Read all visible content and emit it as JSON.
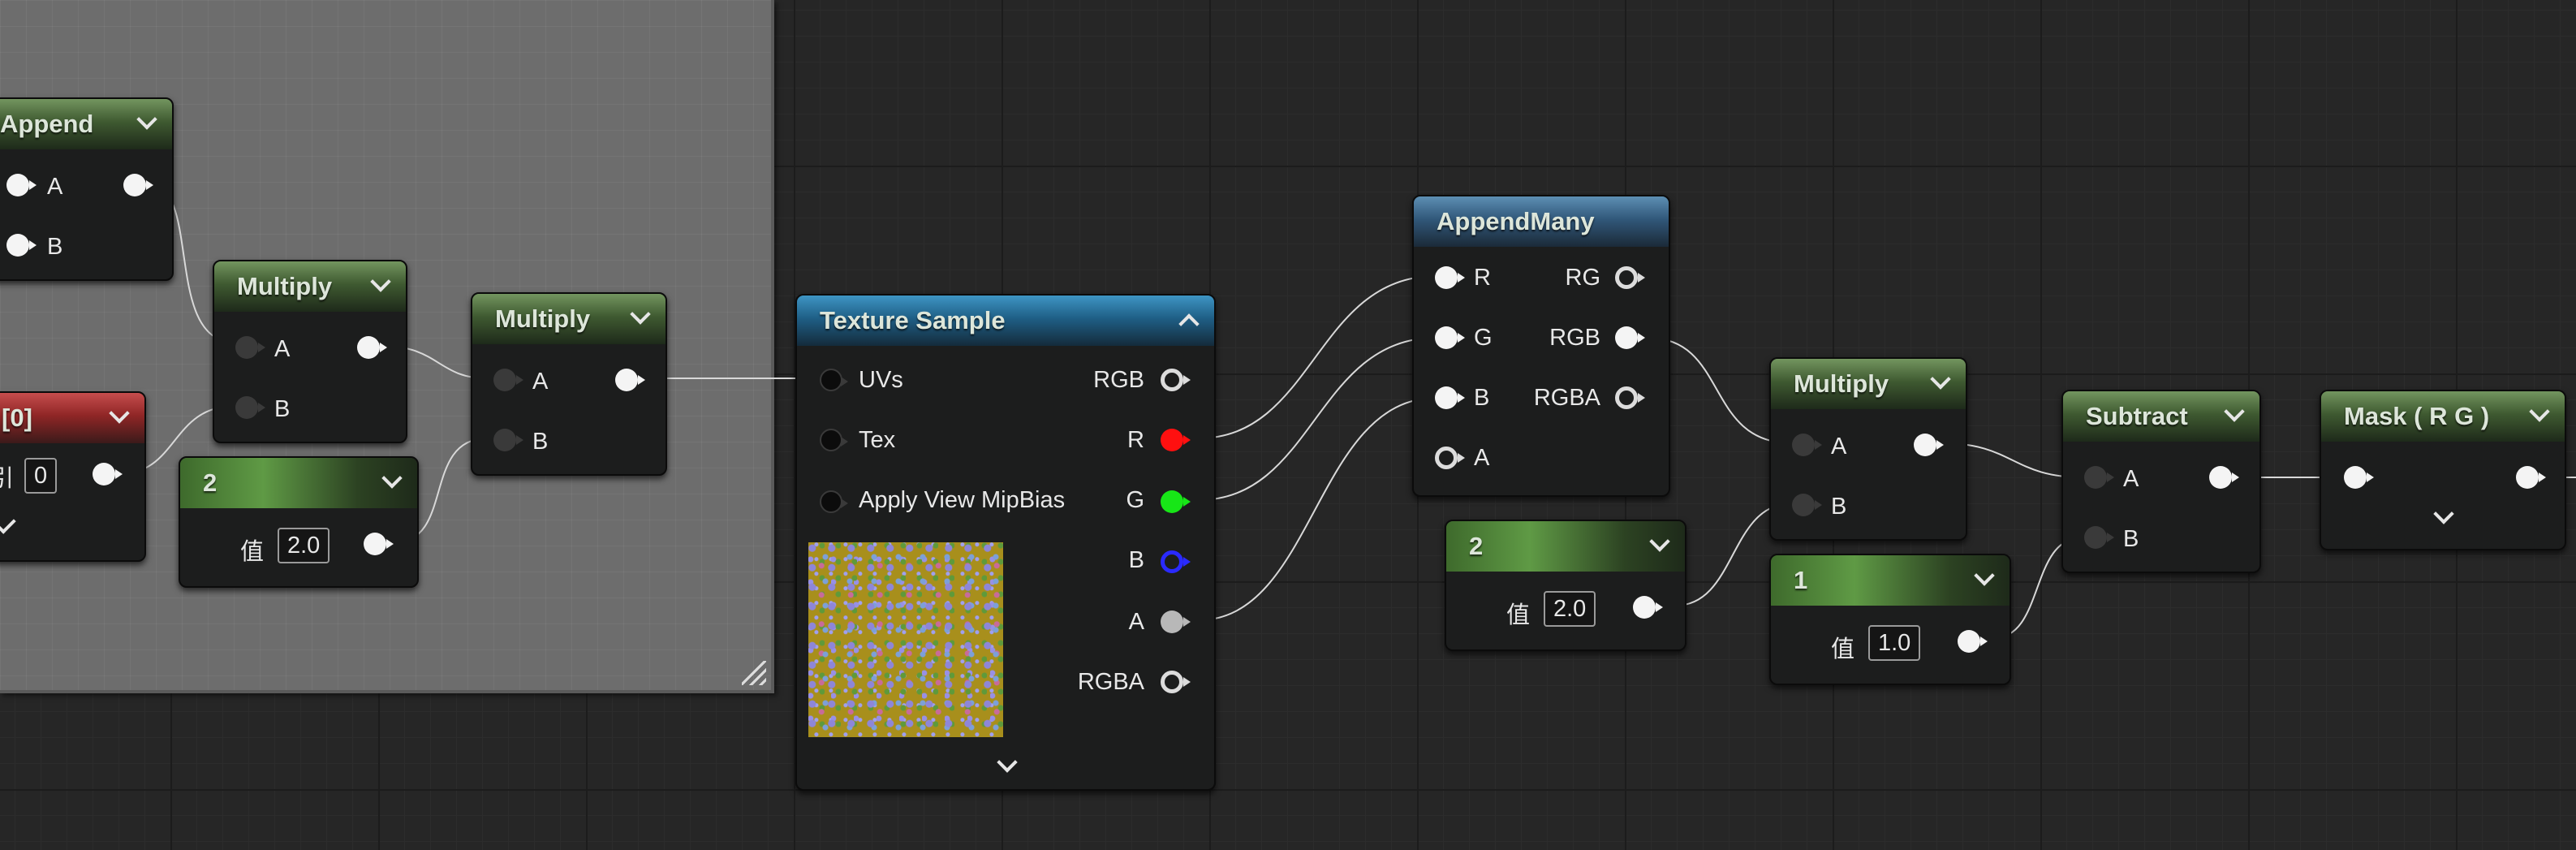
{
  "const_value_label": "值",
  "nodes": {
    "append": {
      "title": "Append",
      "pins": {
        "a": "A",
        "b": "B"
      }
    },
    "multiply1": {
      "title": "Multiply",
      "pins": {
        "a": "A",
        "b": "B"
      }
    },
    "multiply2": {
      "title": "Multiply",
      "pins": {
        "a": "A",
        "b": "B"
      }
    },
    "red_param": {
      "title": "[0]",
      "label_fragment": "引",
      "value": "0"
    },
    "const_2_left": {
      "title": "2",
      "value": "2.0"
    },
    "texture_sample": {
      "title": "Texture Sample",
      "inputs": {
        "uvs": "UVs",
        "tex": "Tex",
        "mip": "Apply View MipBias"
      },
      "outputs": {
        "rgb": "RGB",
        "r": "R",
        "g": "G",
        "b": "B",
        "a": "A",
        "rgba": "RGBA"
      }
    },
    "append_many": {
      "title": "AppendMany",
      "inputs": {
        "r": "R",
        "g": "G",
        "b": "B",
        "a": "A"
      },
      "outputs": {
        "rg": "RG",
        "rgb": "RGB",
        "rgba": "RGBA"
      }
    },
    "multiply3": {
      "title": "Multiply",
      "pins": {
        "a": "A",
        "b": "B"
      }
    },
    "const_2_right": {
      "title": "2",
      "value": "2.0"
    },
    "const_1": {
      "title": "1",
      "value": "1.0"
    },
    "subtract": {
      "title": "Subtract",
      "pins": {
        "a": "A",
        "b": "B"
      }
    },
    "mask": {
      "title": "Mask ( R G )"
    }
  },
  "colors": {
    "graph_background": "#262626",
    "comment_box": "#6d6d6d",
    "pin_red": "#ff1010",
    "pin_green": "#17e617",
    "pin_blue": "#2a2aff",
    "header_math_green": "#3f5a31",
    "header_texture_blue": "#1f5f86",
    "header_param_red": "#8f2626"
  }
}
